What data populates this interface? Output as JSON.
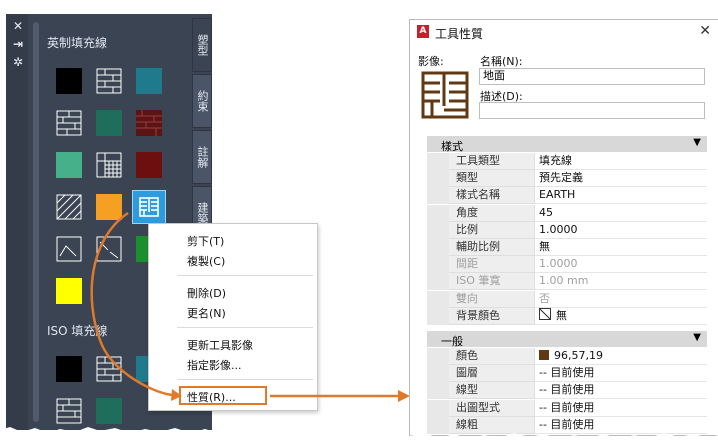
{
  "palette": {
    "controls": [
      "✕",
      "⇥",
      "✲"
    ],
    "sections": [
      {
        "title": "英制填充線"
      },
      {
        "title": "ISO 填充線"
      }
    ],
    "tabs": [
      "塑型",
      "約束",
      "註解",
      "建築"
    ],
    "colors": {
      "bg": "#3b4453",
      "black": "#000000",
      "teal": "#1f7a8c",
      "green": "#1f6e5c",
      "mint": "#46b08a",
      "maroon": "#6e0f0f",
      "orange": "#f5a023",
      "yellow": "#ffff00",
      "accent": "#2d9be0"
    }
  },
  "context_menu": {
    "items": [
      "剪下(T)",
      "複製(C)",
      "刪除(D)",
      "更名(N)",
      "更新工具影像",
      "指定影像...",
      "性質(R)..."
    ]
  },
  "dialog": {
    "title": "工具性質",
    "image_label": "影像:",
    "name_label": "名稱(N):",
    "name_value": "地面",
    "desc_label": "描述(D):",
    "desc_value": "",
    "sections": [
      {
        "title": "樣式",
        "rows": [
          {
            "key": "工具類型",
            "value": "填充線"
          },
          {
            "key": "類型",
            "value": "預先定義"
          },
          {
            "key": "樣式名稱",
            "value": "EARTH"
          },
          {
            "key": "角度",
            "value": "45"
          },
          {
            "key": "比例",
            "value": "1.0000"
          },
          {
            "key": "輔助比例",
            "value": "無"
          },
          {
            "key": "間距",
            "value": "1.0000",
            "dim": true
          },
          {
            "key": "ISO 筆寬",
            "value": "1.00 mm",
            "dim": true
          },
          {
            "key": "雙向",
            "value": "否",
            "dim": true
          },
          {
            "key": "背景顏色",
            "value": "無"
          }
        ]
      },
      {
        "title": "一般",
        "rows": [
          {
            "key": "顏色",
            "value": "96,57,19"
          },
          {
            "key": "圖層",
            "value": "-- 目前使用"
          },
          {
            "key": "線型",
            "value": "-- 目前使用"
          },
          {
            "key": "出圖型式",
            "value": "-- 目前使用"
          },
          {
            "key": "線粗",
            "value": "-- 目前使用"
          }
        ]
      }
    ],
    "color_swatch": "#603913"
  }
}
